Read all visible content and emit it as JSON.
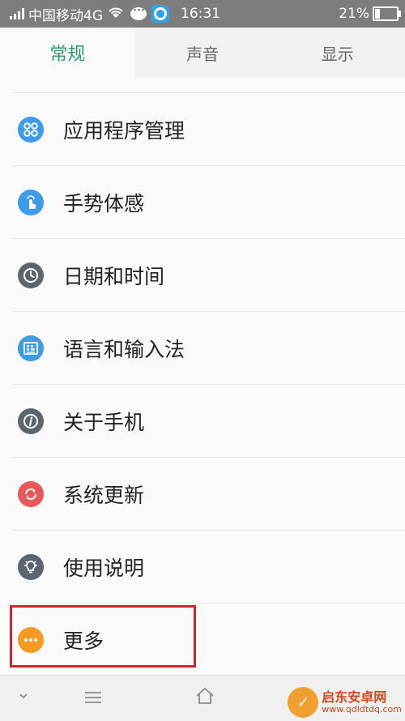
{
  "status_bar": {
    "carrier": "中国移动4G",
    "time": "16:31",
    "battery_percent": "21%",
    "battery_level": 0.21,
    "icons": [
      "signal-icon",
      "wifi-icon",
      "chat-icon",
      "app-icon"
    ]
  },
  "tabs": [
    {
      "label": "常规",
      "active": true
    },
    {
      "label": "声音",
      "active": false
    },
    {
      "label": "显示",
      "active": false
    }
  ],
  "settings_items": [
    {
      "label": "应用程序管理",
      "icon": "apps-icon",
      "color": "#3d9be9"
    },
    {
      "label": "手势体感",
      "icon": "gesture-icon",
      "color": "#3d9be9"
    },
    {
      "label": "日期和时间",
      "icon": "clock-icon",
      "color": "#5a6570"
    },
    {
      "label": "语言和输入法",
      "icon": "keyboard-icon",
      "color": "#3d9be9"
    },
    {
      "label": "关于手机",
      "icon": "info-icon",
      "color": "#5a6570"
    },
    {
      "label": "系统更新",
      "icon": "refresh-icon",
      "color": "#e85a5a"
    },
    {
      "label": "使用说明",
      "icon": "lightbulb-icon",
      "color": "#5a6570"
    },
    {
      "label": "更多",
      "icon": "more-icon",
      "color": "#f29a22"
    }
  ],
  "watermark": {
    "title": "启东安卓网",
    "url": "www.qdldtdq.com"
  },
  "colors": {
    "accent": "#2a9d6f",
    "highlight_box": "#c8282f",
    "status_bar": "#7d7d7d"
  }
}
